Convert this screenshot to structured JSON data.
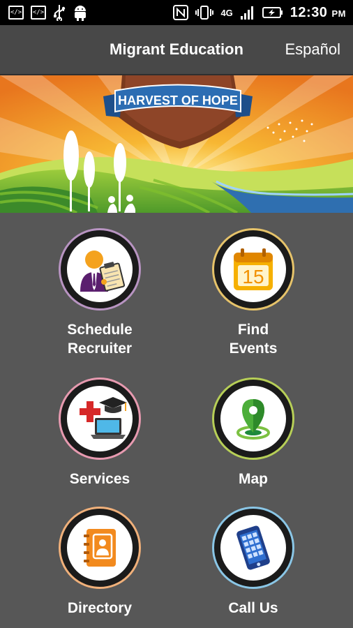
{
  "status_bar": {
    "time": "12:30",
    "ampm": "PM",
    "network": "4G",
    "dev_icon_label": "</>"
  },
  "app_bar": {
    "title": "Migrant Education",
    "language_link": "Español"
  },
  "banner": {
    "ribbon_text": "HARVEST OF HOPE"
  },
  "menu": [
    {
      "label_line1": "Schedule",
      "label_line2": "Recruiter",
      "icon": "recruiter-icon",
      "ring_color": "#b894c2"
    },
    {
      "label_line1": "Find",
      "label_line2": "Events",
      "icon": "calendar-icon",
      "ring_color": "#e6c36a",
      "calendar_day": "15"
    },
    {
      "label_line1": "Services",
      "label_line2": "",
      "icon": "services-icon",
      "ring_color": "#e79ab0"
    },
    {
      "label_line1": "Map",
      "label_line2": "",
      "icon": "map-pin-icon",
      "ring_color": "#b7cf57"
    },
    {
      "label_line1": "Directory",
      "label_line2": "",
      "icon": "contact-book-icon",
      "ring_color": "#f0b07a"
    },
    {
      "label_line1": "Call Us",
      "label_line2": "",
      "icon": "phone-icon",
      "ring_color": "#8ac6e6"
    }
  ]
}
